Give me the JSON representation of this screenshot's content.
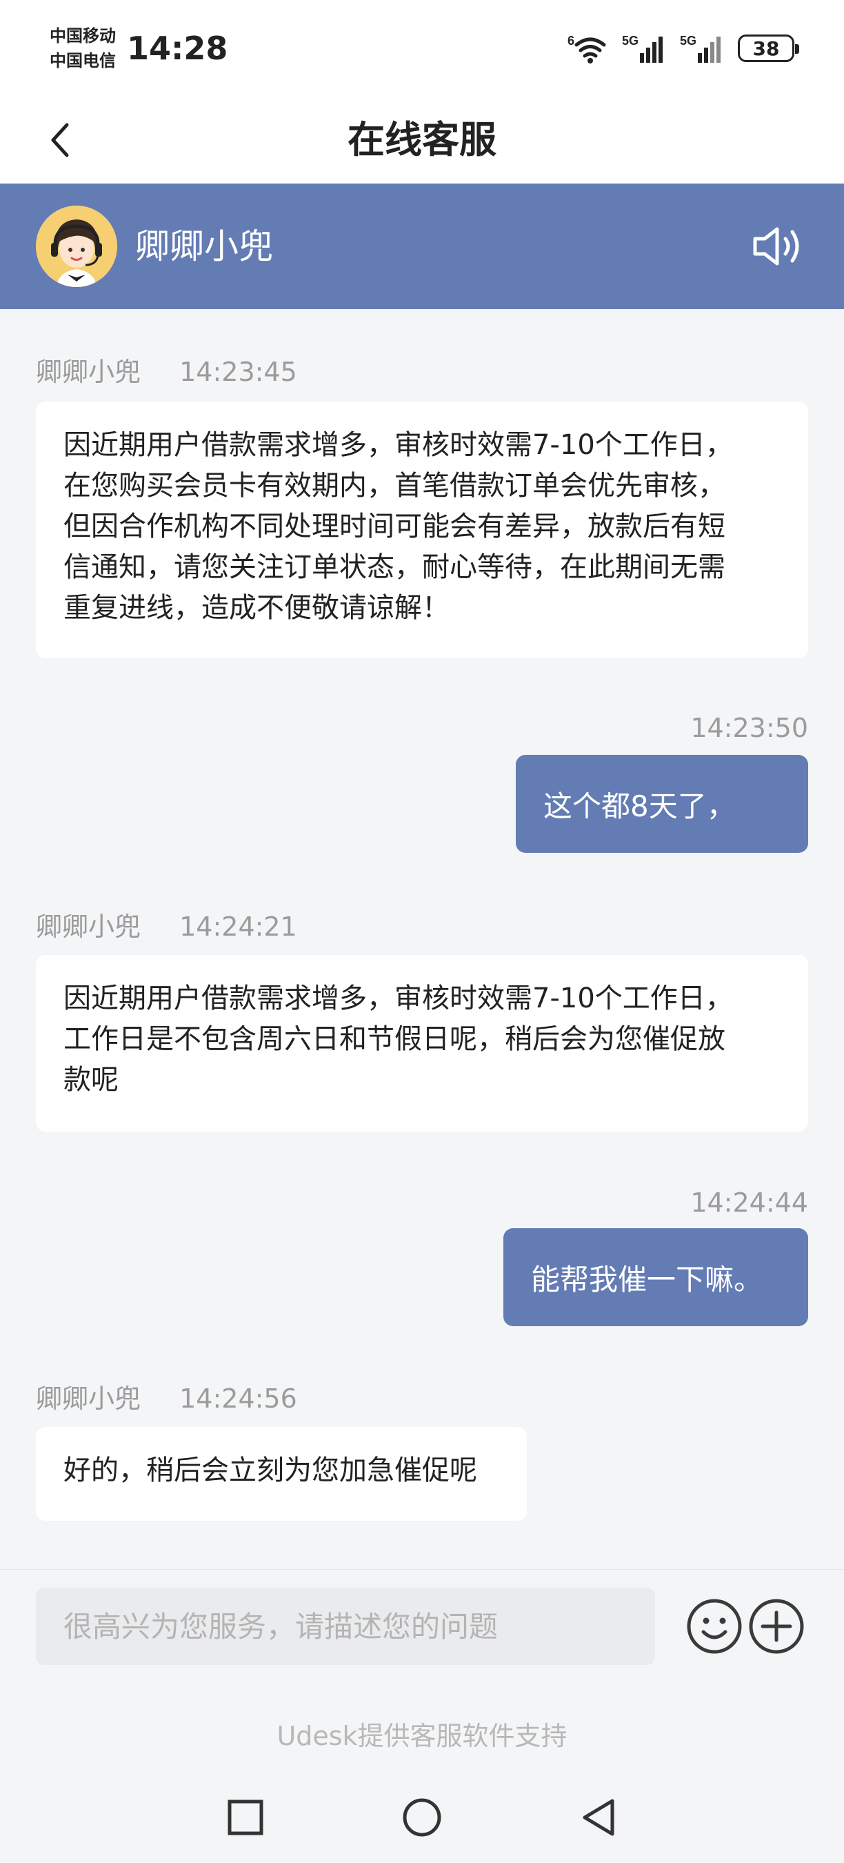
{
  "status_bar": {
    "carrier_1": "中国移动",
    "carrier_2": "中国电信",
    "time": "14:28",
    "wifi_badge": "6",
    "signal_1_label": "5G",
    "signal_2_label": "5G",
    "battery": "38"
  },
  "header": {
    "title": "在线客服",
    "back_icon": "chevron-left-icon"
  },
  "agent": {
    "name": "卿卿小兜",
    "speaker_icon": "speaker-icon"
  },
  "messages": [
    {
      "direction": "incoming",
      "sender": "卿卿小兜",
      "time": "14:23:45",
      "lines": [
        "因近期用户借款需求增多，审核时效需7-10个工作日，",
        "在您购买会员卡有效期内，首笔借款订单会优先审核，",
        "但因合作机构不同处理时间可能会有差异，放款后有短",
        "信通知，请您关注订单状态，耐心等待，在此期间无需",
        "重复进线，造成不便敬请谅解！"
      ]
    },
    {
      "direction": "outgoing",
      "time": "14:23:50",
      "text": "这个都8天了，"
    },
    {
      "direction": "incoming",
      "sender": "卿卿小兜",
      "time": "14:24:21",
      "lines": [
        "因近期用户借款需求增多，审核时效需7-10个工作日，",
        "工作日是不包含周六日和节假日呢，稍后会为您催促放",
        "款呢"
      ]
    },
    {
      "direction": "outgoing",
      "time": "14:24:44",
      "text": "能帮我催一下嘛。"
    },
    {
      "direction": "incoming",
      "sender": "卿卿小兜",
      "time": "14:24:56",
      "lines": [
        "好的，稍后会立刻为您加急催促呢"
      ]
    }
  ],
  "input": {
    "value": "",
    "placeholder": "很高兴为您服务，请描述您的问题",
    "emoji_icon": "smiley-icon",
    "plus_icon": "plus-circle-icon"
  },
  "footer": {
    "powered_by": "Udesk提供客服软件支持"
  },
  "colors": {
    "accent": "#647cb4",
    "background": "#f4f5f7",
    "meta_text": "#9b9b9b"
  }
}
